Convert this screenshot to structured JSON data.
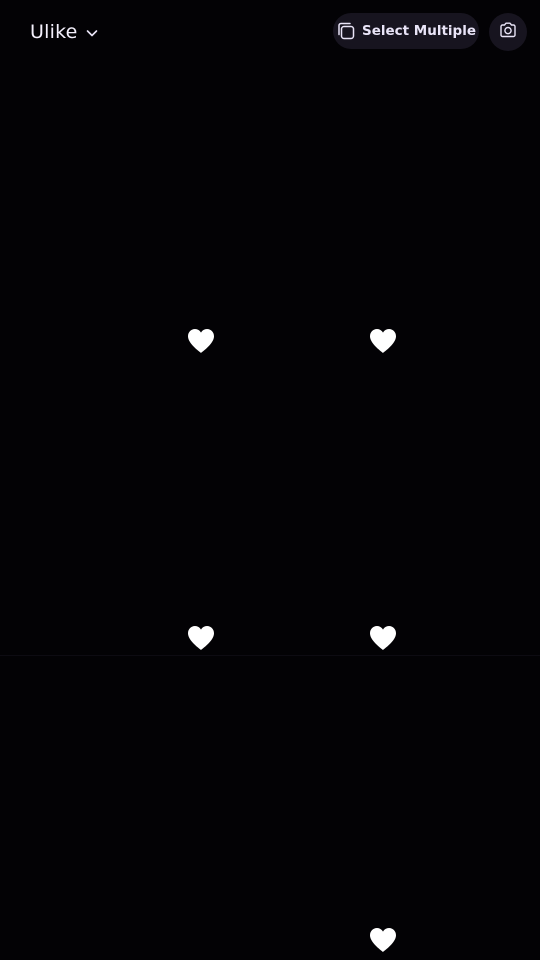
{
  "header": {
    "album_title": "Ulike",
    "select_multiple_label": "Select Multiple"
  },
  "icons": {
    "chevron": "chevron-down-icon",
    "select_multiple": "select-multiple-icon",
    "camera": "camera-icon",
    "favorite": "heart-icon"
  },
  "colors": {
    "background": "#030205",
    "pill_background": "#17141f",
    "text": "#f2eefb",
    "heart": "#ffffff"
  },
  "grid": {
    "tiles": [
      {
        "favorited": true
      },
      {
        "favorited": true
      },
      {
        "favorited": true
      },
      {
        "favorited": true
      },
      {
        "favorited": true
      },
      {
        "favorited": true
      },
      {
        "favorited": true
      }
    ]
  }
}
